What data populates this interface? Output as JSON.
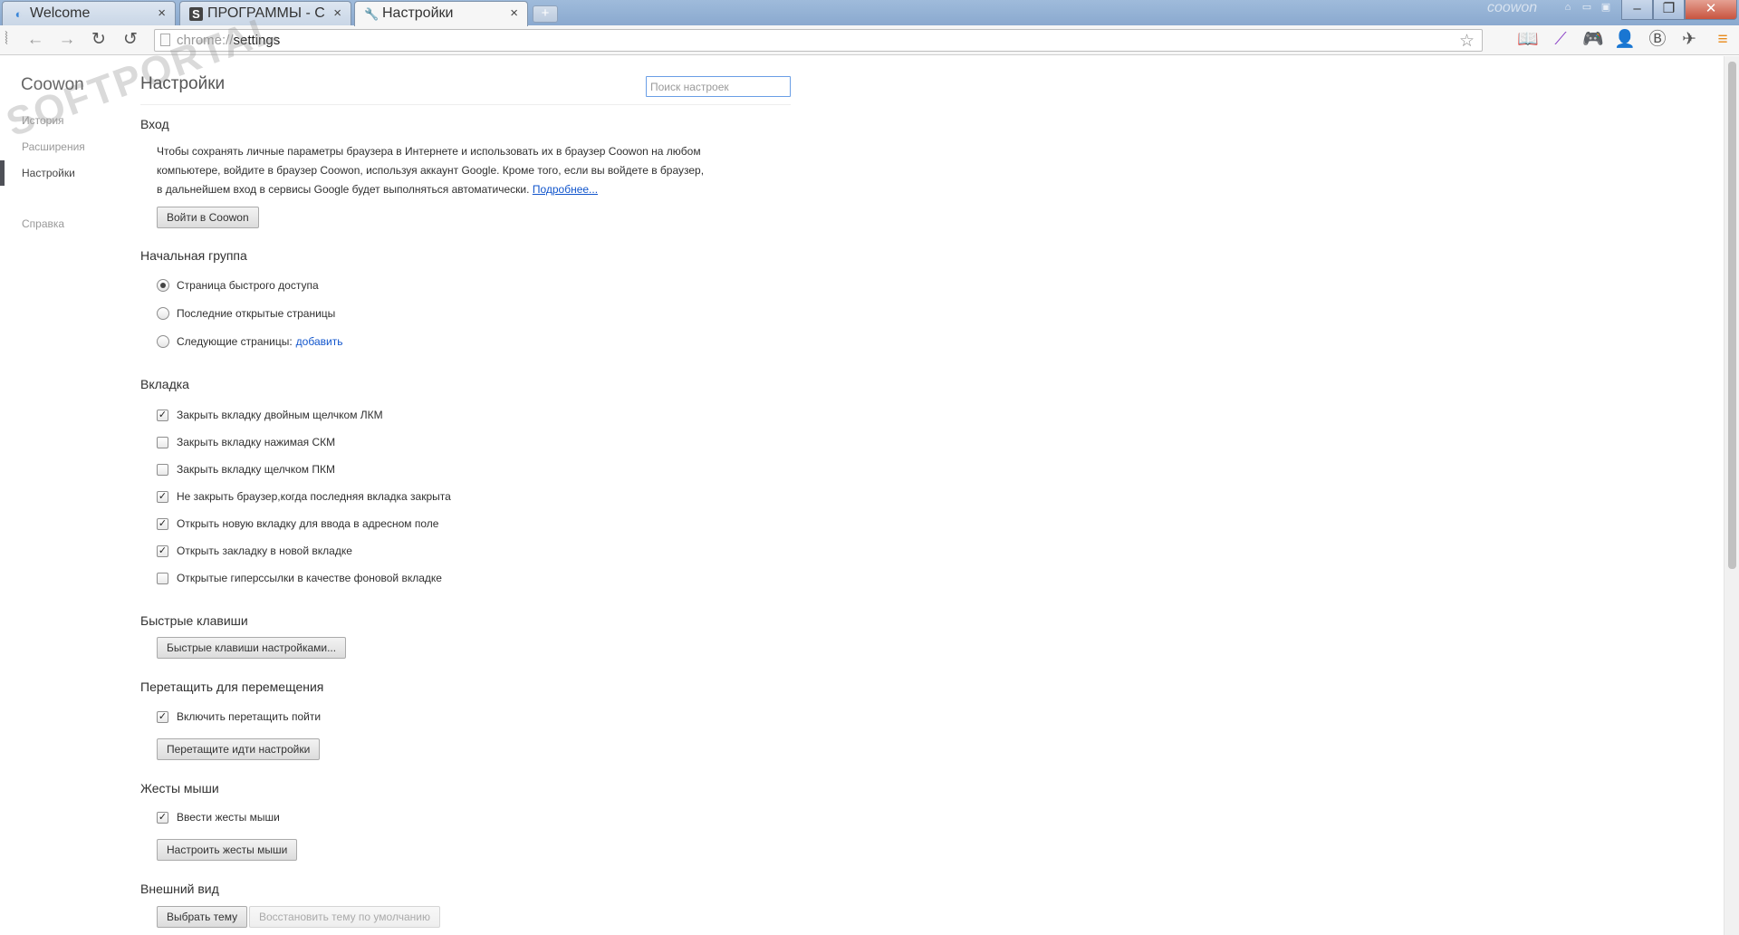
{
  "tabs": [
    {
      "title": "Welcome",
      "favicon": "coowon-logo-icon",
      "active": false
    },
    {
      "title": "ПРОГРАММЫ - Скачать",
      "favicon": "softportal-s-icon",
      "active": false
    },
    {
      "title": "Настройки",
      "favicon": "wrench-icon",
      "active": true
    }
  ],
  "titlebar": {
    "brand": "coowon"
  },
  "omnibox": {
    "scheme": "chrome://",
    "path": "settings"
  },
  "sidebar": {
    "brand": "Coowon",
    "items": [
      {
        "label": "История"
      },
      {
        "label": "Расширения"
      },
      {
        "label": "Настройки",
        "selected": true
      },
      {
        "label": "Справка"
      }
    ],
    "watermark": "SOFTPORTAL"
  },
  "main": {
    "title": "Настройки",
    "search_placeholder": "Поиск настроек",
    "signin": {
      "title": "Вход",
      "desc_line1": "Чтобы сохранять личные параметры браузера в Интернете и использовать их в браузер Coowon на любом",
      "desc_line2": "компьютере, войдите в браузер Coowon, используя аккаунт Google. Кроме того, если вы войдете в браузер,",
      "desc_line3": "в дальнейшем вход в сервисы Google будет выполняться автоматически.",
      "link": "Подробнее...",
      "button": "Войти в Coowon"
    },
    "startup": {
      "title": "Начальная группа",
      "options": [
        {
          "label": "Страница быстрого доступа",
          "selected": true
        },
        {
          "label": "Последние открытые страницы",
          "selected": false
        },
        {
          "label": "Следующие страницы:",
          "selected": false
        }
      ],
      "add_link": "добавить"
    },
    "tabs_section": {
      "title": "Вкладка",
      "options": [
        {
          "label": "Закрыть вкладку двойным щелчком ЛКМ",
          "checked": true
        },
        {
          "label": "Закрыть вкладку нажимая СКМ",
          "checked": false
        },
        {
          "label": "Закрыть вкладку щелчком ПКМ",
          "checked": false
        },
        {
          "label": "Не закрыть браузер,когда последняя вкладка закрыта",
          "checked": true
        },
        {
          "label": "Открыть новую вкладку для ввода в адресном поле",
          "checked": true
        },
        {
          "label": "Открыть закладку в новой вкладке",
          "checked": true
        },
        {
          "label": "Открытые гиперссылки в качестве фоновой вкладке",
          "checked": false
        }
      ]
    },
    "hotkeys": {
      "title": "Быстрые клавиши",
      "button": "Быстрые клавиши настройками..."
    },
    "drag": {
      "title": "Перетащить для перемещения",
      "option": {
        "label": "Включить перетащить пойти",
        "checked": true
      },
      "button": "Перетащите идти настройки"
    },
    "gestures": {
      "title": "Жесты мыши",
      "option": {
        "label": "Ввести жесты мыши",
        "checked": true
      },
      "button": "Настроить жесты мыши"
    },
    "appearance": {
      "title": "Внешний вид",
      "button_theme": "Выбрать тему",
      "button_reset": "Восстановить тему по умолчанию"
    }
  },
  "colors": {
    "link": "#1155cc",
    "focus": "#6a9ee6",
    "tabstrip": "#9fbbdb"
  }
}
